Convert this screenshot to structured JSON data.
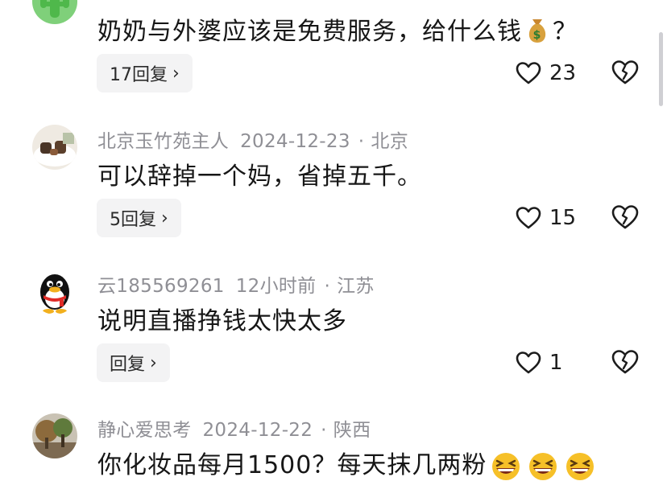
{
  "comments": [
    {
      "user": "",
      "date": "",
      "location": "",
      "text": "奶奶与外婆应该是免费服务，给什么钱",
      "text_suffix": "？",
      "emoji": "money-bag",
      "reply_label": "17回复",
      "likes": "23"
    },
    {
      "user": "北京玉竹苑主人",
      "date": "2024-12-23",
      "location": "北京",
      "text": "可以辞掉一个妈，省掉五千。",
      "reply_label": "5回复",
      "likes": "15"
    },
    {
      "user": "云185569261",
      "date": "12小时前",
      "location": "江苏",
      "text": "说明直播挣钱太快太多",
      "reply_label": "回复",
      "likes": "1"
    },
    {
      "user": "静心爱思考",
      "date": "2024-12-22",
      "location": "陕西",
      "text": "你化妆品每月1500？每天抹几两粉",
      "emoji": "grinning-squinting-face x3"
    }
  ],
  "separator": "·",
  "colors": {
    "meta": "#8f8f95",
    "text": "#161616",
    "reply_bg": "#f3f3f4"
  }
}
